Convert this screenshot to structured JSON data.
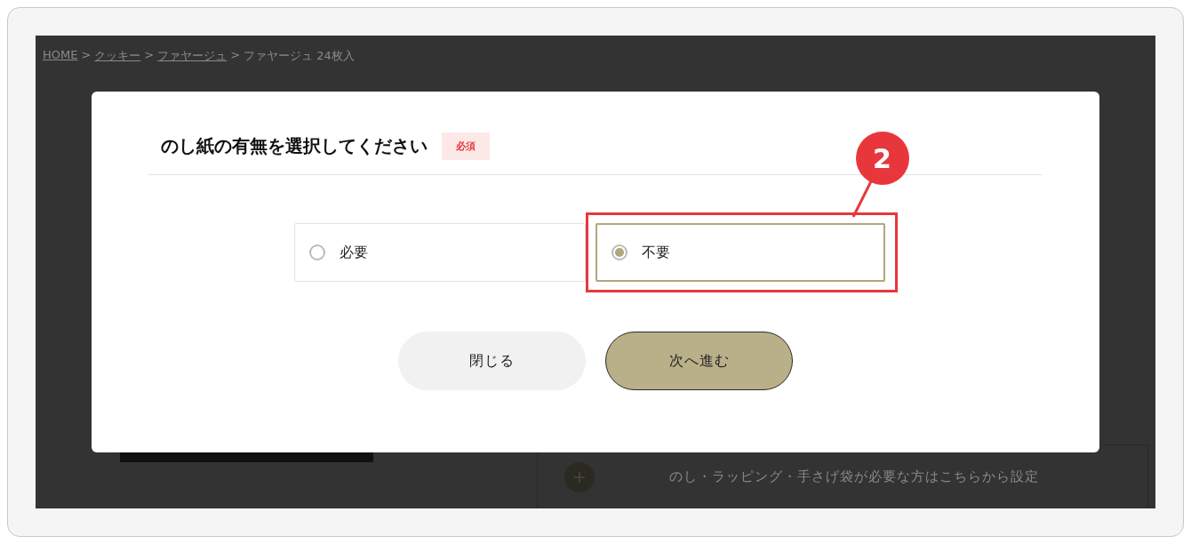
{
  "breadcrumb": [
    {
      "label": "HOME",
      "link": true
    },
    {
      "separator": ">",
      "label": "クッキー",
      "link": true
    },
    {
      "separator": ">",
      "label": "ファヤージュ",
      "link": true
    },
    {
      "separator": ">",
      "label": "ファヤージュ 24枚入",
      "link": false
    }
  ],
  "background_panel": {
    "text": "のし・ラッピング・手さげ袋が必要な方はこちらから設定"
  },
  "dialog": {
    "title": "のし紙の有無を選択してください",
    "badge": "必須",
    "options": [
      {
        "label": "必要",
        "selected": false,
        "highlighted": false
      },
      {
        "label": "不要",
        "selected": true,
        "highlighted": true
      }
    ],
    "buttons": [
      {
        "label": "閉じる",
        "kind": "secondary"
      },
      {
        "label": "次へ進む",
        "kind": "primary"
      }
    ]
  },
  "annotation": {
    "label": "2"
  }
}
